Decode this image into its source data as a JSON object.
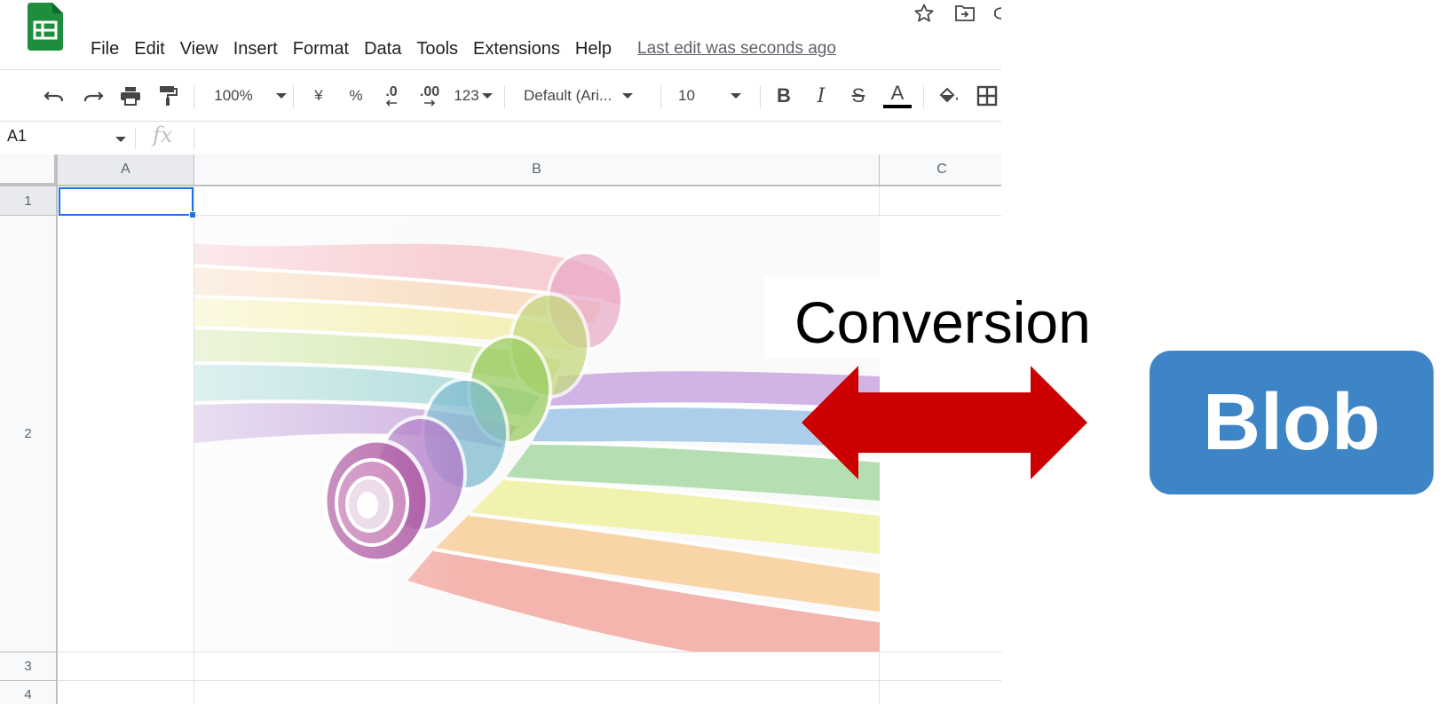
{
  "menu": {
    "items": [
      "File",
      "Edit",
      "View",
      "Insert",
      "Format",
      "Data",
      "Tools",
      "Extensions",
      "Help"
    ],
    "last_edit": "Last edit was seconds ago"
  },
  "toolbar": {
    "zoom": "100%",
    "currency": "¥",
    "percent": "%",
    "decrease_decimal": ".0",
    "increase_decimal": ".00",
    "more_formats": "123",
    "font": "Default (Ari...",
    "font_size": "10",
    "bold": "B",
    "italic": "I",
    "strike": "S",
    "text_color_letter": "A",
    "text_color": "#000000"
  },
  "formula_bar": {
    "cell_ref": "A1",
    "fx": "fx"
  },
  "grid": {
    "columns": [
      "A",
      "B",
      "C"
    ],
    "rows": [
      "1",
      "2",
      "3",
      "4"
    ]
  },
  "overlay": {
    "conversion_label": "Conversion",
    "blob_label": "Blob",
    "arrow_color": "#cc0000",
    "blob_color": "#3d85c6"
  },
  "colors": {
    "selection": "#1a73e8",
    "sheets_green": "#1e8e3e"
  }
}
